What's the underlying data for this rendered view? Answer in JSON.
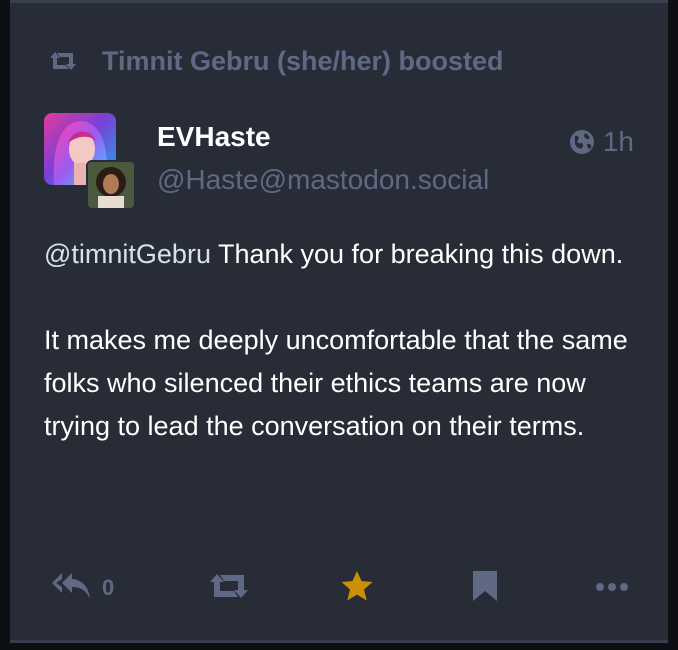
{
  "boost": {
    "icon": "retweet-icon",
    "text": "Timnit Gebru (she/her) boosted"
  },
  "status": {
    "display_name": "EVHaste",
    "handle": "@Haste@mastodon.social",
    "visibility_icon": "globe-icon",
    "time": "1h",
    "mention": "@timnitGebru",
    "paragraph1_rest": " Thank you for breaking this down.",
    "paragraph2": "It makes me deeply uncomfortable that the same folks who silenced their ethics teams are now trying to lead the conversation on their terms."
  },
  "actions": {
    "reply_icon": "reply-all-icon",
    "reply_count": "0",
    "boost_icon": "retweet-icon",
    "favourite_icon": "star-icon",
    "bookmark_icon": "bookmark-icon",
    "more_icon": "ellipsis-icon"
  },
  "colors": {
    "card_bg": "#282c37",
    "muted": "#606984",
    "star_active": "#ca8f04",
    "text": "#ffffff"
  }
}
